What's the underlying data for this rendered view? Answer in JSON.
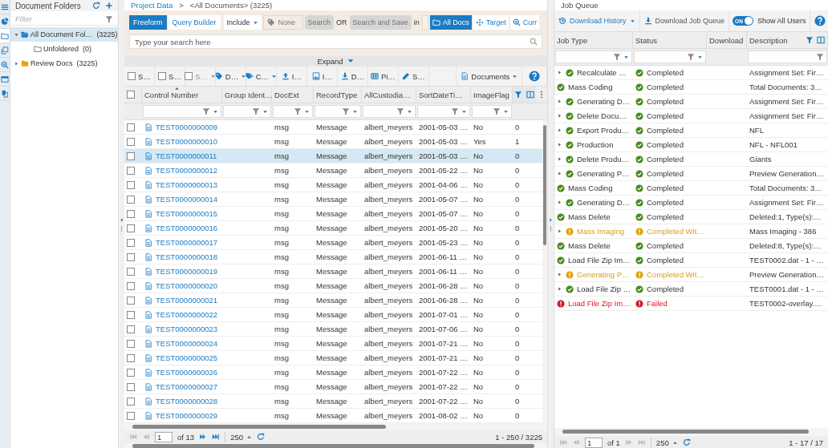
{
  "rail": [
    {
      "kind": "menu",
      "selected": false
    },
    {
      "kind": "pie",
      "selected": false
    },
    {
      "kind": "folder",
      "selected": true
    },
    {
      "kind": "copy",
      "selected": false
    },
    {
      "kind": "zoom",
      "selected": false
    },
    {
      "kind": "window",
      "selected": false
    },
    {
      "kind": "docs",
      "selected": false
    }
  ],
  "folders": {
    "title": "Document Folders",
    "filter_placeholder": "Filter",
    "tree": [
      {
        "label": "All Document Fol…",
        "count": "(3225)",
        "kind": "open",
        "selected": true,
        "expanded": true,
        "children": [
          {
            "label": "Unfoldered",
            "count": "(0)",
            "kind": "empty",
            "selected": false
          }
        ]
      },
      {
        "label": "Review Docs",
        "count": "(3225)",
        "kind": "closed",
        "selected": false,
        "expanded": false
      }
    ]
  },
  "breadcrumb": {
    "link": "Project Data",
    "separator": ">",
    "current": "<All Documents> (3225)"
  },
  "search": {
    "modes": [
      {
        "label": "Freeform",
        "selected": true
      },
      {
        "label": "Query Builder",
        "selected": false
      }
    ],
    "include": "Include",
    "tag": "None",
    "search_button": {
      "label": "Search",
      "disabled": true
    },
    "or": "OR",
    "save_button": {
      "label": "Search and Save",
      "disabled": true
    },
    "in": "in",
    "scopes": [
      {
        "label": "All Docs",
        "kind": "folder",
        "selected": true
      },
      {
        "label": "Target",
        "kind": "target",
        "selected": false
      },
      {
        "label": "Curr",
        "kind": "zoom",
        "selected": false
      }
    ],
    "placeholder": "Type your search here",
    "expand": "Expand"
  },
  "actions": [
    {
      "label": "S…",
      "kind": "checkbox",
      "caret": false,
      "disabled": false
    },
    {
      "label": "S…",
      "kind": "checkbox",
      "caret": false,
      "disabled": false
    },
    {
      "label": "S…",
      "kind": "checkbox",
      "caret": true,
      "disabled": true
    },
    {
      "label": "D…",
      "kind": "tag",
      "caret": true,
      "disabled": false
    },
    {
      "label": "C…",
      "kind": "tags",
      "caret": true,
      "disabled": false
    },
    {
      "label": "I…",
      "kind": "upload",
      "caret": false,
      "disabled": false
    },
    {
      "label": "I…",
      "kind": "image",
      "caret": false,
      "disabled": false
    },
    {
      "label": "D…",
      "kind": "download",
      "caret": false,
      "disabled": false
    },
    {
      "label": "Pi…",
      "kind": "table",
      "caret": false,
      "disabled": false
    },
    {
      "label": "S…",
      "kind": "pen",
      "caret": false,
      "disabled": false
    }
  ],
  "view_menu": "Documents",
  "table": {
    "select_all_checked": false,
    "columns": [
      {
        "label": "Control Number",
        "sorted": true
      },
      {
        "label": "Group Ident…",
        "sorted": false
      },
      {
        "label": "DocExt",
        "sorted": false
      },
      {
        "label": "RecordType",
        "sorted": false
      },
      {
        "label": "AllCustodia…",
        "sorted": false
      },
      {
        "label": "SortDateTi…",
        "sorted": false
      },
      {
        "label": "ImageFlag",
        "sorted": false
      }
    ],
    "rows": [
      {
        "checked": false,
        "selected": false,
        "control": "TEST0000000009",
        "docext": "msg",
        "record": "Message",
        "custodian": "albert_meyers",
        "sortdate": "2001-05-03 …",
        "imageflag": "No",
        "column_9": "0"
      },
      {
        "checked": false,
        "selected": false,
        "control": "TEST0000000010",
        "docext": "msg",
        "record": "Message",
        "custodian": "albert_meyers",
        "sortdate": "2001-05-03 …",
        "imageflag": "Yes",
        "column_9": "1"
      },
      {
        "checked": false,
        "selected": true,
        "control": "TEST0000000011",
        "docext": "msg",
        "record": "Message",
        "custodian": "albert_meyers",
        "sortdate": "2001-05-03 …",
        "imageflag": "No",
        "column_9": "0"
      },
      {
        "checked": false,
        "selected": false,
        "control": "TEST0000000012",
        "docext": "msg",
        "record": "Message",
        "custodian": "albert_meyers",
        "sortdate": "2001-05-22 …",
        "imageflag": "No",
        "column_9": "0"
      },
      {
        "checked": false,
        "selected": false,
        "control": "TEST0000000013",
        "docext": "msg",
        "record": "Message",
        "custodian": "albert_meyers",
        "sortdate": "2001-04-06 …",
        "imageflag": "No",
        "column_9": "0"
      },
      {
        "checked": false,
        "selected": false,
        "control": "TEST0000000014",
        "docext": "msg",
        "record": "Message",
        "custodian": "albert_meyers",
        "sortdate": "2001-05-07 …",
        "imageflag": "No",
        "column_9": "0"
      },
      {
        "checked": false,
        "selected": false,
        "control": "TEST0000000015",
        "docext": "msg",
        "record": "Message",
        "custodian": "albert_meyers",
        "sortdate": "2001-05-07 …",
        "imageflag": "No",
        "column_9": "0"
      },
      {
        "checked": false,
        "selected": false,
        "control": "TEST0000000016",
        "docext": "msg",
        "record": "Message",
        "custodian": "albert_meyers",
        "sortdate": "2001-05-20 …",
        "imageflag": "No",
        "column_9": "0"
      },
      {
        "checked": false,
        "selected": false,
        "control": "TEST0000000017",
        "docext": "msg",
        "record": "Message",
        "custodian": "albert_meyers",
        "sortdate": "2001-05-23 …",
        "imageflag": "No",
        "column_9": "0"
      },
      {
        "checked": false,
        "selected": false,
        "control": "TEST0000000018",
        "docext": "msg",
        "record": "Message",
        "custodian": "albert_meyers",
        "sortdate": "2001-06-11 …",
        "imageflag": "No",
        "column_9": "0"
      },
      {
        "checked": false,
        "selected": false,
        "control": "TEST0000000019",
        "docext": "msg",
        "record": "Message",
        "custodian": "albert_meyers",
        "sortdate": "2001-06-11 …",
        "imageflag": "No",
        "column_9": "0"
      },
      {
        "checked": false,
        "selected": false,
        "control": "TEST0000000020",
        "docext": "msg",
        "record": "Message",
        "custodian": "albert_meyers",
        "sortdate": "2001-06-28 …",
        "imageflag": "No",
        "column_9": "0"
      },
      {
        "checked": false,
        "selected": false,
        "control": "TEST0000000021",
        "docext": "msg",
        "record": "Message",
        "custodian": "albert_meyers",
        "sortdate": "2001-06-28 …",
        "imageflag": "No",
        "column_9": "0"
      },
      {
        "checked": false,
        "selected": false,
        "control": "TEST0000000022",
        "docext": "msg",
        "record": "Message",
        "custodian": "albert_meyers",
        "sortdate": "2001-07-01 …",
        "imageflag": "No",
        "column_9": "0"
      },
      {
        "checked": false,
        "selected": false,
        "control": "TEST0000000023",
        "docext": "msg",
        "record": "Message",
        "custodian": "albert_meyers",
        "sortdate": "2001-07-06 …",
        "imageflag": "No",
        "column_9": "0"
      },
      {
        "checked": false,
        "selected": false,
        "control": "TEST0000000024",
        "docext": "msg",
        "record": "Message",
        "custodian": "albert_meyers",
        "sortdate": "2001-07-21 …",
        "imageflag": "No",
        "column_9": "0"
      },
      {
        "checked": false,
        "selected": false,
        "control": "TEST0000000025",
        "docext": "msg",
        "record": "Message",
        "custodian": "albert_meyers",
        "sortdate": "2001-07-21 …",
        "imageflag": "No",
        "column_9": "0"
      },
      {
        "checked": false,
        "selected": false,
        "control": "TEST0000000026",
        "docext": "msg",
        "record": "Message",
        "custodian": "albert_meyers",
        "sortdate": "2001-07-22 …",
        "imageflag": "No",
        "column_9": "0"
      },
      {
        "checked": false,
        "selected": false,
        "control": "TEST0000000027",
        "docext": "msg",
        "record": "Message",
        "custodian": "albert_meyers",
        "sortdate": "2001-07-22 …",
        "imageflag": "No",
        "column_9": "0"
      },
      {
        "checked": false,
        "selected": false,
        "control": "TEST0000000028",
        "docext": "msg",
        "record": "Message",
        "custodian": "albert_meyers",
        "sortdate": "2001-07-22 …",
        "imageflag": "No",
        "column_9": "0"
      },
      {
        "checked": false,
        "selected": false,
        "control": "TEST0000000029",
        "docext": "msg",
        "record": "Message",
        "custodian": "albert_meyers",
        "sortdate": "2001-08-02 …",
        "imageflag": "No",
        "column_9": "0"
      }
    ]
  },
  "pager": {
    "nav": [
      {
        "kind": "first",
        "disabled": true
      },
      {
        "kind": "prev",
        "disabled": true
      }
    ],
    "page": "1",
    "of": "of 13",
    "nav_after": [
      {
        "kind": "next",
        "disabled": false
      },
      {
        "kind": "last",
        "disabled": false
      }
    ],
    "page_size": "250",
    "range": "1 - 250 / 3225"
  },
  "job_queue": {
    "title": "Job Queue",
    "history": "Download History",
    "download": "Download Job Queue",
    "show_all": {
      "label": "Show All Users",
      "on": true,
      "state_text": "ON"
    },
    "columns": [
      "Job Type",
      "Status",
      "Download",
      "Description"
    ],
    "rows": [
      {
        "job": "Recalculate …",
        "expandable": true,
        "kind": "completed",
        "status": "Completed",
        "description": "Assignment Set: Fir…"
      },
      {
        "job": "Mass Coding",
        "expandable": false,
        "kind": "completed",
        "status": "Completed",
        "description": "Total Documents: 3…"
      },
      {
        "job": "Generating D…",
        "expandable": true,
        "kind": "completed",
        "status": "Completed",
        "description": "Assignment Set: Fir…"
      },
      {
        "job": "Delete Docu…",
        "expandable": true,
        "kind": "completed",
        "status": "Completed",
        "description": "Assignment Set: Fir…"
      },
      {
        "job": "Export Produ…",
        "expandable": true,
        "kind": "completed",
        "status": "Completed",
        "description": "NFL"
      },
      {
        "job": "Production",
        "expandable": true,
        "kind": "completed",
        "status": "Completed",
        "description": "NFL - NFL001"
      },
      {
        "job": "Delete Produ…",
        "expandable": true,
        "kind": "completed",
        "status": "Completed",
        "description": "Giants"
      },
      {
        "job": "Generating P…",
        "expandable": true,
        "kind": "completed",
        "status": "Completed",
        "description": "Preview Generation…"
      },
      {
        "job": "Mass Coding",
        "expandable": false,
        "kind": "completed",
        "status": "Completed",
        "description": "Total Documents: 3…"
      },
      {
        "job": "Generating D…",
        "expandable": true,
        "kind": "completed",
        "status": "Completed",
        "description": "Assignment Set: Fir…"
      },
      {
        "job": "Mass Delete",
        "expandable": false,
        "kind": "completed",
        "status": "Completed",
        "description": "Deleted:1, Type(s):…"
      },
      {
        "job": "Mass Imaging",
        "expandable": true,
        "kind": "warning",
        "status": "Completed Wit…",
        "description": "Mass Imaging - 386"
      },
      {
        "job": "Mass Delete",
        "expandable": false,
        "kind": "completed",
        "status": "Completed",
        "description": "Deleted:8, Type(s):…"
      },
      {
        "job": "Load File Zip Im…",
        "expandable": false,
        "kind": "completed",
        "status": "Completed",
        "description": "TEST0002.dat - 1 - …"
      },
      {
        "job": "Generating P…",
        "expandable": true,
        "kind": "warning",
        "status": "Completed Wit…",
        "description": "Preview Generation…"
      },
      {
        "job": "Load File Zip …",
        "expandable": true,
        "kind": "completed",
        "status": "Completed",
        "description": "TEST0001.dat - 1 - …"
      },
      {
        "job": "Load File Zip Im…",
        "expandable": false,
        "kind": "failed",
        "status": "Failed",
        "description": "TEST0002-overlay.…"
      }
    ],
    "pager": {
      "nav": [
        {
          "kind": "first",
          "disabled": true
        },
        {
          "kind": "prev",
          "disabled": true
        }
      ],
      "page": "1",
      "of": "of 1",
      "nav_after": [
        {
          "kind": "next",
          "disabled": true
        },
        {
          "kind": "last",
          "disabled": true
        }
      ],
      "page_size": "250",
      "range": "1 - 17 / 17"
    }
  }
}
